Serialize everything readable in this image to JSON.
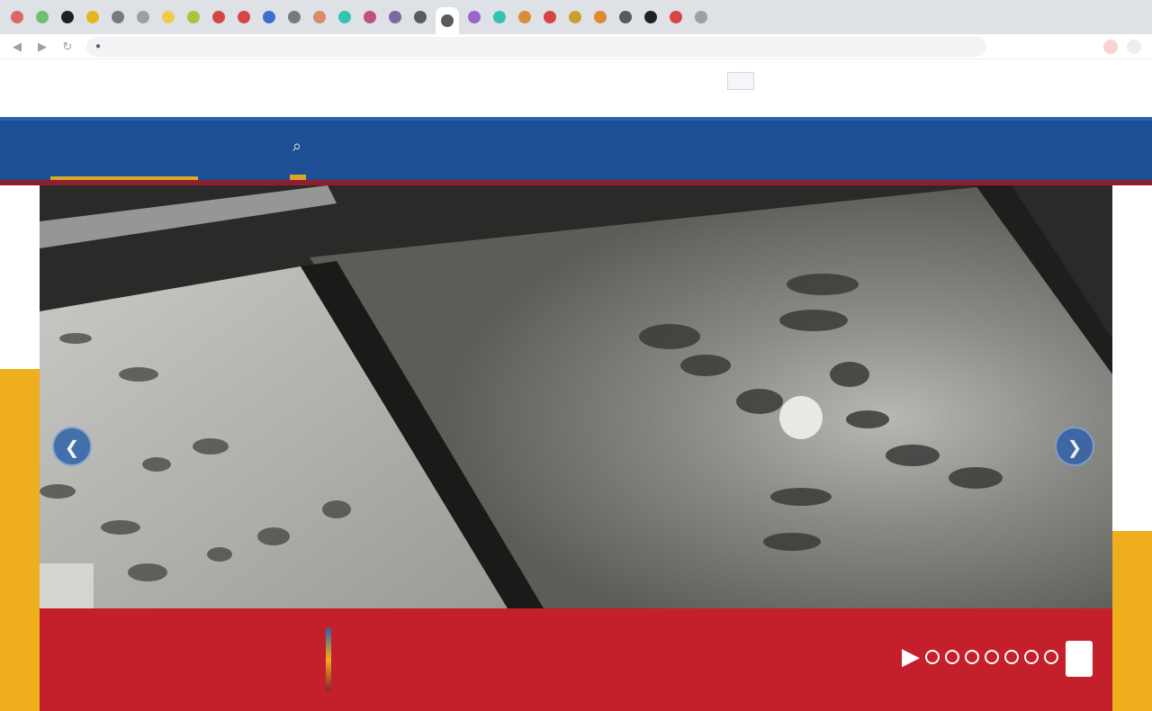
{
  "browser": {
    "tab_colors": [
      "#e06666",
      "#6fbf73",
      "#202124",
      "#e6b325",
      "#7a7a7a",
      "#9aa0a6",
      "#f2c94c",
      "#a8c63a",
      "#d64545",
      "#d64545",
      "#3c6fd1",
      "#7a7a7a",
      "#d98c6a",
      "#35c2b0",
      "#c05080",
      "#7a6aa0",
      "#5a5a5a",
      "#5a5a5a",
      "#9966cc",
      "#35c2b0",
      "#d98c3a",
      "#d64545",
      "#c9a030",
      "#e08a30",
      "#5a5a5a",
      "#202124",
      "#d64545",
      "#9aa0a6"
    ],
    "nav_back": "◀",
    "nav_forward": "▶",
    "nav_reload": "↻",
    "url": "",
    "toolbar_pill_red": "",
    "toolbar_pill_grey": ""
  },
  "utility_nav": {
    "items": [
      "",
      "",
      "",
      "",
      "",
      ""
    ],
    "sign_in": "",
    "donate": ""
  },
  "main_nav": {
    "logo": "",
    "search_icon": "⌕",
    "items": [
      "",
      "",
      "",
      "",
      "",
      "",
      ""
    ]
  },
  "hero": {
    "prev_icon": "❮",
    "next_icon": "❯"
  },
  "caption": {
    "title": "",
    "text": "",
    "play_icon": "▶"
  },
  "colors": {
    "brand_blue": "#1c4f93",
    "brand_red": "#c3202b",
    "accent_yellow": "#efae1c"
  }
}
